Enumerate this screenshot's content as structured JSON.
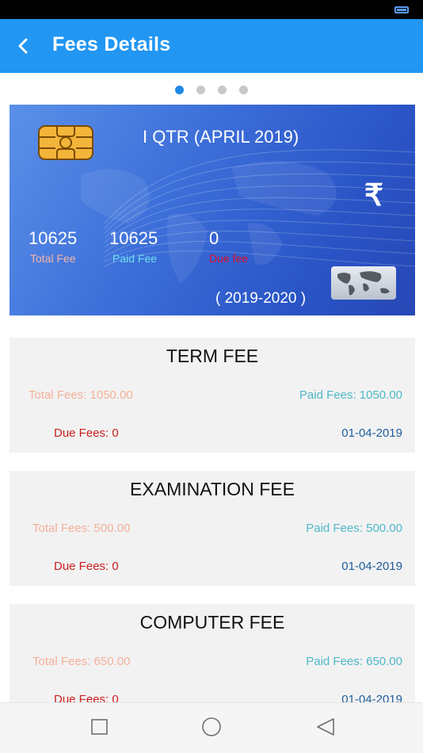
{
  "header": {
    "title": "Fees Details"
  },
  "pager": {
    "count": 4,
    "active": 0
  },
  "card": {
    "title": "I QTR (APRIL 2019)",
    "total_fee": "10625",
    "total_fee_label": "Total Fee",
    "paid_fee": "10625",
    "paid_fee_label": "Paid Fee",
    "due_fee": "0",
    "due_fee_label": "Due fee",
    "year": "( 2019-2020 )",
    "currency_symbol": "₹",
    "colors": {
      "total_label": "#f7b3a5",
      "paid_label": "#6ee0f0",
      "due_label": "#e0102a"
    }
  },
  "fees": [
    {
      "title": "TERM FEE",
      "total": "Total Fees: 1050.00",
      "paid": "Paid Fees: 1050.00",
      "due": "Due Fees: 0",
      "date": "01-04-2019"
    },
    {
      "title": "EXAMINATION FEE",
      "total": "Total Fees: 500.00",
      "paid": "Paid Fees: 500.00",
      "due": "Due Fees: 0",
      "date": "01-04-2019"
    },
    {
      "title": "COMPUTER FEE",
      "total": "Total Fees: 650.00",
      "paid": "Paid Fees: 650.00",
      "due": "Due Fees: 0",
      "date": "01-04-2019"
    }
  ],
  "icons": {
    "back": "back-arrow-icon",
    "chip": "sim-chip-icon",
    "rupee": "rupee-icon",
    "map": "world-map-icon",
    "nav": [
      "square-recents-icon",
      "circle-home-icon",
      "triangle-back-icon"
    ]
  },
  "theme": {
    "primary": "#2196f3",
    "indicator_active": "#1e88e5"
  }
}
